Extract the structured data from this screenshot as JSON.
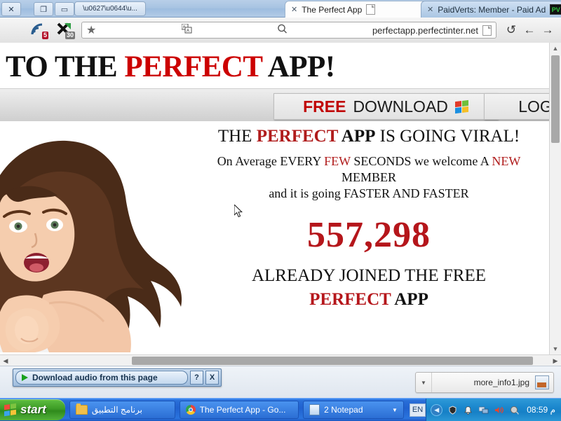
{
  "window": {
    "close_label": "✕",
    "restore_label": "❐",
    "minimize_label": "▭",
    "wintab_label": "\\u0627\\u0644\\u..."
  },
  "tabs": [
    {
      "title": "The Perfect App",
      "close": "✕",
      "icon": "page-icon",
      "active": true
    },
    {
      "title": "PaidVerts: Member - Paid Ad",
      "close": "✕",
      "icon": "pv-badge",
      "active": false
    }
  ],
  "toolbar": {
    "menu_icon": "hamburger-icon",
    "adblock_badge": "5",
    "blocker_badge": "30",
    "star_icon": "★",
    "translate_icon": "translate-icon",
    "search_icon": "⌕",
    "url": "perfectapp.perfectinter.net",
    "reload_icon": "↺",
    "back_icon": "←",
    "forward_icon": "→"
  },
  "page": {
    "hero_prefix": "TO THE ",
    "hero_red": "PERFECT",
    "hero_suffix": " APP!",
    "buttons": {
      "download_red": "FREE",
      "download_black": "DOWNLOAD",
      "download_icon": "windows-logo-icon",
      "login": "LOGIN"
    },
    "viral_1": "THE ",
    "viral_red": "PERFECT",
    "viral_2": " APP",
    "viral_3": " IS GOING VIRAL!",
    "sub_1": "On Average EVERY ",
    "sub_red1": "FEW",
    "sub_2": " SECONDS we welcome A ",
    "sub_red2": "NEW",
    "sub_3": "MEMBER",
    "sub_4": "and it is going FASTER AND FASTER",
    "counter": "557,298",
    "joined_1": "ALREADY JOINED THE FREE",
    "joined_red": "PERFECT",
    "joined_2": " APP",
    "photo_alt": "excited-woman-pointing-photo"
  },
  "scrollbars": {
    "up_arrow": "▲",
    "down_arrow": "▼",
    "left_arrow": "◀",
    "right_arrow": "▶"
  },
  "audio_bar": {
    "label": "Download audio from this page",
    "play_icon": "play-icon",
    "help_label": "?",
    "close_label": "X"
  },
  "download_item": {
    "caret": "▼",
    "filename": "more_info1.jpg",
    "thumb_icon": "image-file-icon"
  },
  "taskbar": {
    "start_label": "start",
    "start_icon": "windows-flag-icon",
    "items": [
      {
        "label": "برنامج التطبيق",
        "icon": "folder-icon"
      },
      {
        "label": "The Perfect App - Go...",
        "icon": "chrome-icon"
      },
      {
        "label": "2 Notepad",
        "icon": "notepad-icon",
        "caret": "▼"
      }
    ],
    "language": "EN",
    "tray_arrow": "◀",
    "tray_icons": [
      "shield-icon",
      "bell-icon",
      "network-icon",
      "volume-icon",
      "update-icon"
    ],
    "clock": "08:59 م"
  },
  "colors": {
    "brand_red": "#b5161b",
    "accent_red": "#cc0000",
    "taskbar_blue": "#2061cf",
    "start_green": "#3d9c26"
  }
}
